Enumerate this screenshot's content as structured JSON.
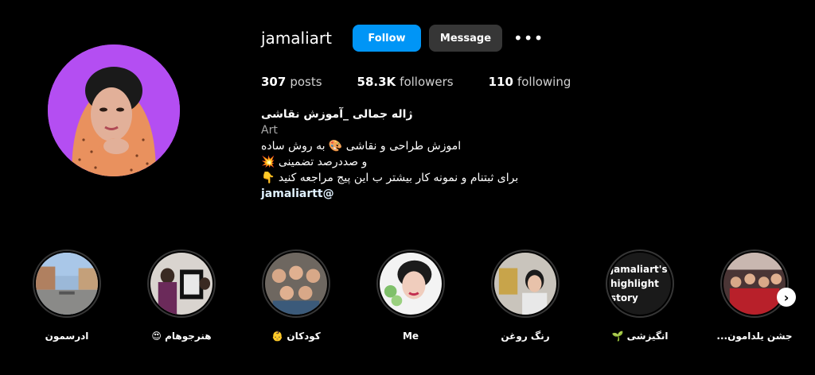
{
  "profile": {
    "username": "jamaliart",
    "follow_label": "Follow",
    "message_label": "Message",
    "more_label": "•••",
    "stats": [
      {
        "count": "307",
        "label": "posts"
      },
      {
        "count": "58.3K",
        "label": "followers"
      },
      {
        "count": "110",
        "label": "following"
      }
    ],
    "full_name": "ژاله جمالی _آموزش نقاشی",
    "category": "Art",
    "bio_lines": [
      "اموزش طراحی و نقاشی 🎨 به روش ساده",
      "و صددرصد تضمینی 💥",
      "برای ثبتنام و نمونه کار بیشتر ب این پیج مراجعه کنید 👇"
    ],
    "link": "jamaliartt@"
  },
  "highlights": [
    {
      "label": "ادرسمون",
      "image": "street"
    },
    {
      "label": "هنرجوهام 😍",
      "image": "students-art"
    },
    {
      "label": "کودکان 👶",
      "image": "children"
    },
    {
      "label": "Me",
      "image": "portrait"
    },
    {
      "label": "رنگ روغن",
      "image": "oil-painting"
    },
    {
      "label": "انگیزشی 🌱",
      "image": "text-story",
      "cover_text": "jamaliart's highlight story"
    },
    {
      "label": "جشن یلدامون...",
      "image": "party"
    }
  ],
  "next_icon": "chevron-right-icon",
  "colors": {
    "follow": "#0095f6",
    "message": "#363636",
    "avatar_bg": "#b44ef2"
  }
}
